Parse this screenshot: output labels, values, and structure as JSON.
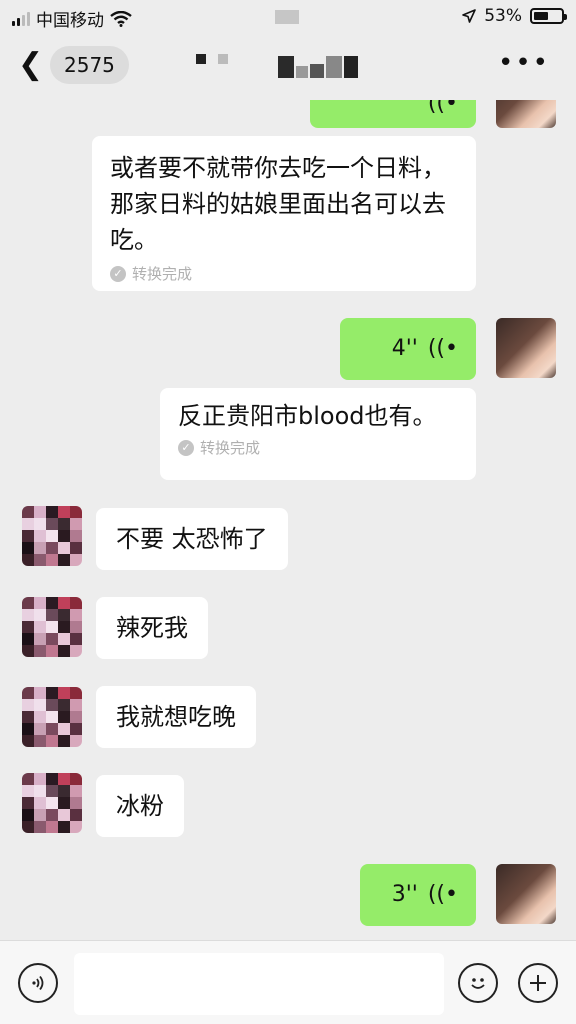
{
  "status_bar": {
    "carrier": "中国移动",
    "battery_percent": "53%",
    "battery_level": 0.53,
    "icons": [
      "signal-icon",
      "wifi-icon",
      "location-icon",
      "battery-icon"
    ]
  },
  "header": {
    "back_count": "2575",
    "title": "",
    "more_label": "•••"
  },
  "messages": [
    {
      "side": "right",
      "type": "voice",
      "duration": ""
    },
    {
      "side": "right",
      "type": "transcription",
      "text": "或者要不就带你去吃一个日料，那家日料的姑娘里面出名可以去吃。",
      "status": "转换完成"
    },
    {
      "side": "right",
      "type": "voice",
      "duration": "4''"
    },
    {
      "side": "right",
      "type": "transcription",
      "text": "反正贵阳市blood也有。",
      "status": "转换完成"
    },
    {
      "side": "left",
      "type": "text",
      "text": "不要 太恐怖了"
    },
    {
      "side": "left",
      "type": "text",
      "text": "辣死我"
    },
    {
      "side": "left",
      "type": "text",
      "text": "我就想吃晚"
    },
    {
      "side": "left",
      "type": "text",
      "text": "冰粉"
    },
    {
      "side": "right",
      "type": "voice",
      "duration": "3''"
    }
  ],
  "input_bar": {
    "placeholder": "",
    "icons": [
      "voice-input-icon",
      "emoji-icon",
      "plus-icon"
    ]
  },
  "colors": {
    "background": "#ededed",
    "outgoing_bubble": "#95ec69",
    "incoming_bubble": "#ffffff"
  }
}
